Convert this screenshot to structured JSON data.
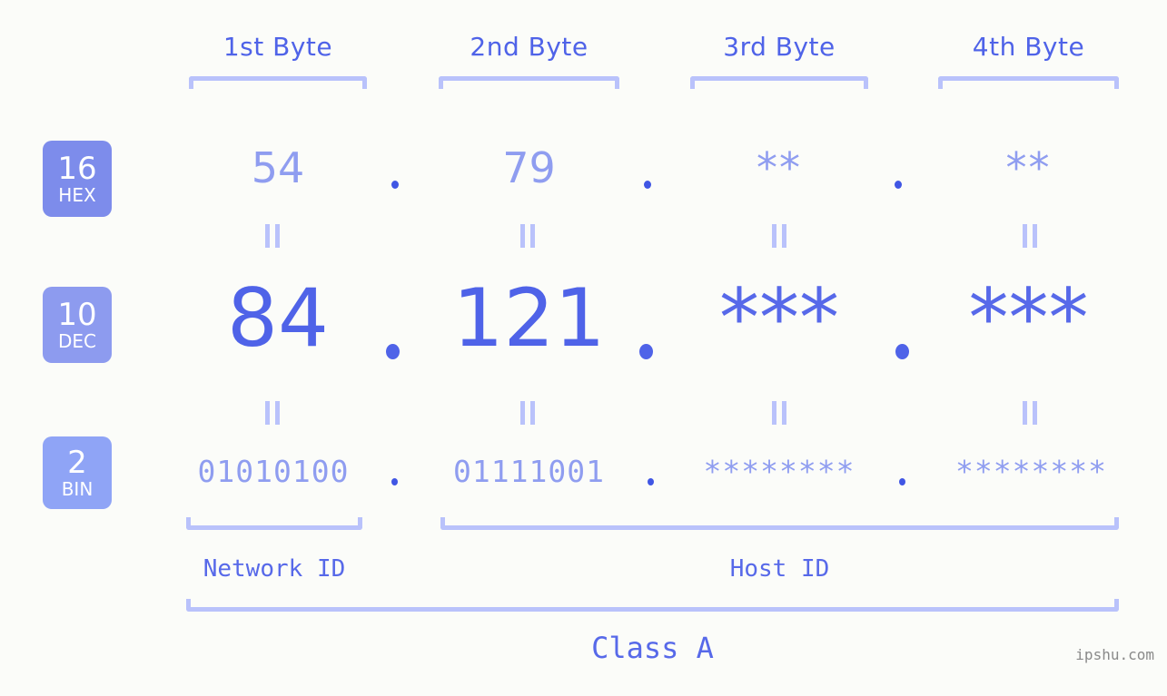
{
  "page": {
    "background_color": "#fbfcf9",
    "accent_color": "#4f63e8",
    "accent_light_color": "#8f9df0",
    "bracket_color": "#b9c2fb",
    "watermark": "ipshu.com"
  },
  "byte_headers": [
    {
      "label": "1st Byte"
    },
    {
      "label": "2nd Byte"
    },
    {
      "label": "3rd Byte"
    },
    {
      "label": "4th Byte"
    }
  ],
  "rows": [
    {
      "base_number": "16",
      "base_name": "HEX",
      "badge_color": "#7d8ceb",
      "values": [
        "54",
        "79",
        "**",
        "**"
      ],
      "separator": "."
    },
    {
      "base_number": "10",
      "base_name": "DEC",
      "badge_color": "#8d9bef",
      "values": [
        "84",
        "121",
        "***",
        "***"
      ],
      "separator": "."
    },
    {
      "base_number": "2",
      "base_name": "BIN",
      "badge_color": "#8fa4f6",
      "values": [
        "01010100",
        "01111001",
        "********",
        "********"
      ],
      "separator": "."
    }
  ],
  "sections": {
    "network_id": "Network ID",
    "host_id": "Host ID",
    "class": "Class A"
  }
}
